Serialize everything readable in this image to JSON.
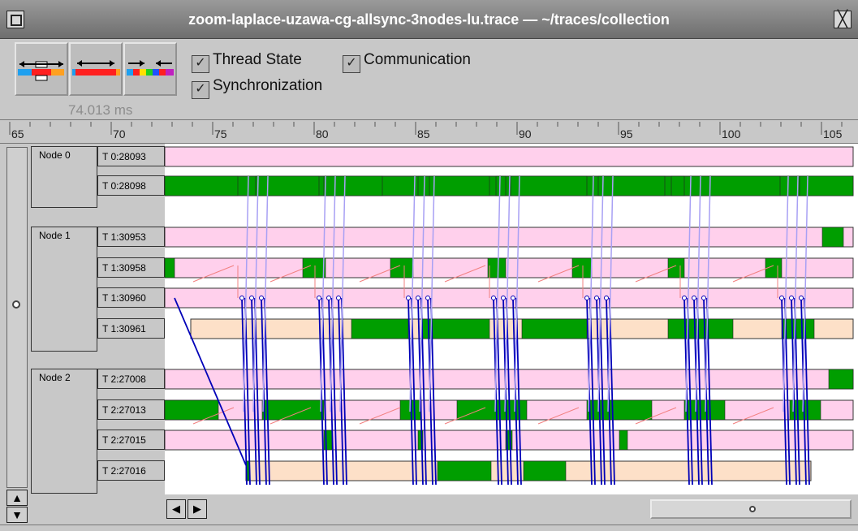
{
  "window": {
    "title": "zoom-laplace-uzawa-cg-allsync-3nodes-lu.trace  —  ~/traces/collection",
    "close_glyph": "╳"
  },
  "toolbar": {
    "duration": "74.013 ms",
    "checkboxes": {
      "thread_state": "Thread State",
      "communication": "Communication",
      "synchronization": "Synchronization"
    },
    "check_glyph": "✓",
    "icons": [
      "zoom-full-icon",
      "zoom-in-icon",
      "zoom-out-icon"
    ]
  },
  "ruler": {
    "ticks": [
      "65",
      "70",
      "75",
      "80",
      "85",
      "90",
      "95",
      "100",
      "105"
    ]
  },
  "colors": {
    "running": "#009e00",
    "waiting": "#ffd0ec",
    "blocked": "#fde0c8",
    "comm": "#0000b8",
    "comm_light": "#a8a0f4",
    "sync": "#f28080"
  },
  "nodes": [
    {
      "label": "Node 0",
      "threads": [
        "T 0:28093",
        "T 0:28098"
      ]
    },
    {
      "label": "Node 1",
      "threads": [
        "T 1:30953",
        "T 1:30958",
        "T 1:30960",
        "T 1:30961"
      ]
    },
    {
      "label": "Node 2",
      "threads": [
        "T 2:27008",
        "T 2:27013",
        "T 2:27015",
        "T 2:27016"
      ]
    }
  ],
  "scroll": {
    "left_glyph": "◀",
    "right_glyph": "▶",
    "up_glyph": "▲",
    "down_glyph": "▼"
  }
}
